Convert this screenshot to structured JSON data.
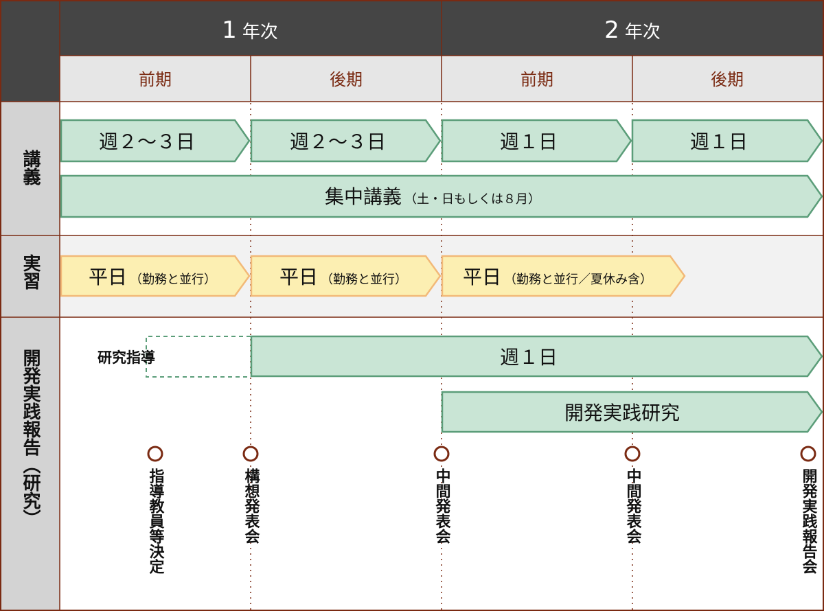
{
  "header": {
    "years": [
      {
        "num": "1",
        "label": "年次"
      },
      {
        "num": "2",
        "label": "年次"
      }
    ],
    "terms": [
      "前期",
      "後期",
      "前期",
      "後期"
    ]
  },
  "rows": {
    "lecture": "講義",
    "practice": "実習",
    "research": "開発実践報告（研究）"
  },
  "bars": {
    "lec_y1_first": {
      "main": "週２～３日"
    },
    "lec_y1_second": {
      "main": "週２～３日"
    },
    "lec_y2_first": {
      "main": "週１日"
    },
    "lec_y2_second": {
      "main": "週１日"
    },
    "lec_intensive": {
      "main": "集中講義",
      "sub": "（土・日もしくは８月）"
    },
    "prac_1": {
      "main": "平日",
      "sub": "（勤務と並行）"
    },
    "prac_2": {
      "main": "平日",
      "sub": "（勤務と並行）"
    },
    "prac_3": {
      "main": "平日",
      "sub": "（勤務と並行／夏休み含）"
    },
    "res_weekly": {
      "main": "週１日"
    },
    "res_dev": {
      "main": "開発実践研究"
    }
  },
  "guidance_label": "研究指導",
  "milestones": [
    "指導教員等決定",
    "構想発表会",
    "中間発表会",
    "中間発表会",
    "開発実践報告会"
  ],
  "colors": {
    "header_dark": "#454545",
    "subheader_bg": "#e6e6e6",
    "label_col_bg": "#d3d3d3",
    "border_brown": "#7a2a12",
    "green_fill": "#c9e5d5",
    "green_stroke": "#5b9d79",
    "yellow_fill": "#fcefb2",
    "yellow_stroke": "#f2b978",
    "practice_band": "#f2f2f2"
  }
}
